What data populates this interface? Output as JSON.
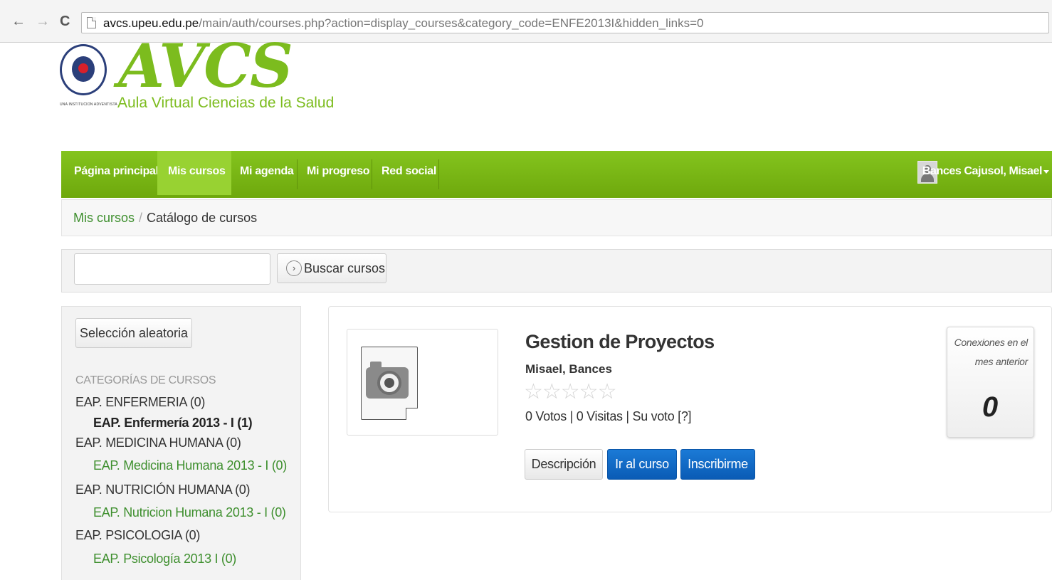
{
  "browser": {
    "back_glyph": "←",
    "forward_glyph": "→",
    "reload_glyph": "C",
    "url_host": "avcs.upeu.edu.pe",
    "url_path": "/main/auth/courses.php?action=display_courses&category_code=ENFE2013I&hidden_links=0"
  },
  "header": {
    "logo_mark": "AVCS",
    "logo_subtitle": "Aula Virtual Ciencias de la Salud",
    "seal_caption": "UNA INSTITUCION ADVENTISTA"
  },
  "nav": {
    "items": [
      {
        "label": "Página principal",
        "active": false
      },
      {
        "label": "Mis cursos",
        "active": true
      },
      {
        "label": "Mi agenda",
        "active": false
      },
      {
        "label": "Mi progreso",
        "active": false
      },
      {
        "label": "Red social",
        "active": false
      }
    ],
    "user_name": "Bances Cajusol, Misael"
  },
  "breadcrumb": {
    "link": "Mis cursos",
    "separator": "/",
    "current": "Catálogo de cursos"
  },
  "search": {
    "value": "",
    "placeholder": "",
    "button_label": "Buscar cursos",
    "button_glyph": "›"
  },
  "sidebar": {
    "random_button": "Selección aleatoria",
    "heading": "CATEGORÍAS DE CURSOS",
    "categories": [
      {
        "label": "EAP. ENFERMERIA (0)"
      },
      {
        "label": "EAP. Enfermería 2013 - I (1)"
      },
      {
        "label": "EAP. MEDICINA HUMANA (0)"
      },
      {
        "label": "EAP. Medicina Humana 2013 - I (0)"
      },
      {
        "label": "EAP. NUTRICIÓN HUMANA (0)"
      },
      {
        "label": "EAP. Nutricion Humana 2013 - I (0)"
      },
      {
        "label": "EAP. PSICOLOGIA (0)"
      },
      {
        "label": "EAP. Psicología 2013 I (0)"
      }
    ]
  },
  "course": {
    "title": "Gestion de Proyectos",
    "teacher": "Misael, Bances",
    "stars": "☆☆☆☆☆",
    "rating": 0,
    "stats": "0 Votos | 0 Visitas | Su voto [?]",
    "buttons": {
      "description": "Descripción",
      "go": "Ir al curso",
      "subscribe": "Inscribirme"
    },
    "connections_label": "Conexiones en el mes anterior",
    "connections_count": "0"
  },
  "colors": {
    "brand_green": "#7cbc1e",
    "nav_green": "#6ea80c",
    "link_green": "#3e8f2e",
    "button_blue": "#0a5bb5"
  }
}
